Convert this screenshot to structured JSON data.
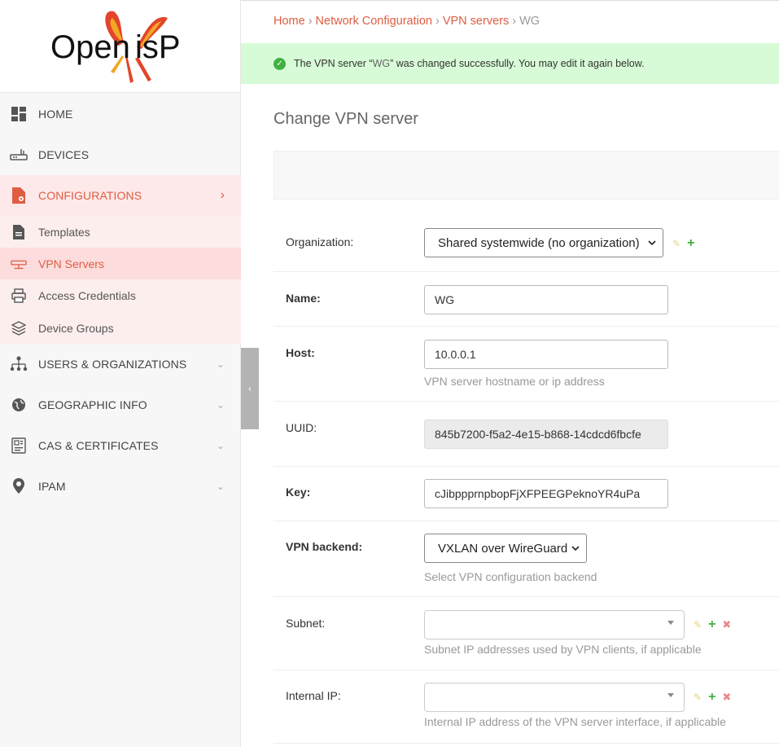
{
  "logo": {
    "text": "OpenWISP",
    "brand_color": "#df5d43"
  },
  "sidebar": {
    "items": [
      {
        "label": "HOME",
        "icon": "dashboard-icon"
      },
      {
        "label": "DEVICES",
        "icon": "router-icon"
      },
      {
        "label": "CONFIGURATIONS",
        "icon": "config-file-icon",
        "active": true,
        "chevron": "›"
      },
      {
        "label": "USERS & ORGANIZATIONS",
        "icon": "org-chart-icon",
        "chevron": "⌄"
      },
      {
        "label": "GEOGRAPHIC INFO",
        "icon": "globe-icon",
        "chevron": "⌄"
      },
      {
        "label": "CAS & CERTIFICATES",
        "icon": "certificate-icon",
        "chevron": "⌄"
      },
      {
        "label": "IPAM",
        "icon": "map-pin-icon",
        "chevron": "⌄"
      }
    ],
    "sub_items": [
      {
        "label": "Templates",
        "icon": "document-icon"
      },
      {
        "label": "VPN Servers",
        "icon": "vpn-icon",
        "active": true
      },
      {
        "label": "Access Credentials",
        "icon": "printer-icon"
      },
      {
        "label": "Device Groups",
        "icon": "layers-icon"
      }
    ],
    "collapse_glyph": "‹"
  },
  "breadcrumb": {
    "home": "Home",
    "section": "Network Configuration",
    "list": "VPN servers",
    "current": "WG",
    "sep": "›"
  },
  "message": {
    "pre": "The VPN server “",
    "name": "WG",
    "post": "” was changed successfully. You may edit it again below.",
    "icon_glyph": "✓"
  },
  "page_title": "Change VPN server",
  "form": {
    "organization": {
      "label": "Organization:",
      "value": "Shared systemwide (no organization)"
    },
    "name": {
      "label": "Name:",
      "value": "WG"
    },
    "host": {
      "label": "Host:",
      "value": "10.0.0.1",
      "help": "VPN server hostname or ip address"
    },
    "uuid": {
      "label": "UUID:",
      "value": "845b7200-f5a2-4e15-b868-14cdcd6fbcfe"
    },
    "key": {
      "label": "Key:",
      "value": "cJibppprnpbopFjXFPEEGPeknoYR4uPa"
    },
    "backend": {
      "label": "VPN backend:",
      "value": "VXLAN over WireGuard",
      "help": "Select VPN configuration backend"
    },
    "subnet": {
      "label": "Subnet:",
      "value": "",
      "help": "Subnet IP addresses used by VPN clients, if applicable"
    },
    "internal_ip": {
      "label": "Internal IP:",
      "value": "",
      "help": "Internal IP address of the VPN server interface, if applicable"
    }
  },
  "actions": {
    "edit": "✎",
    "add": "+",
    "delete": "✖"
  }
}
